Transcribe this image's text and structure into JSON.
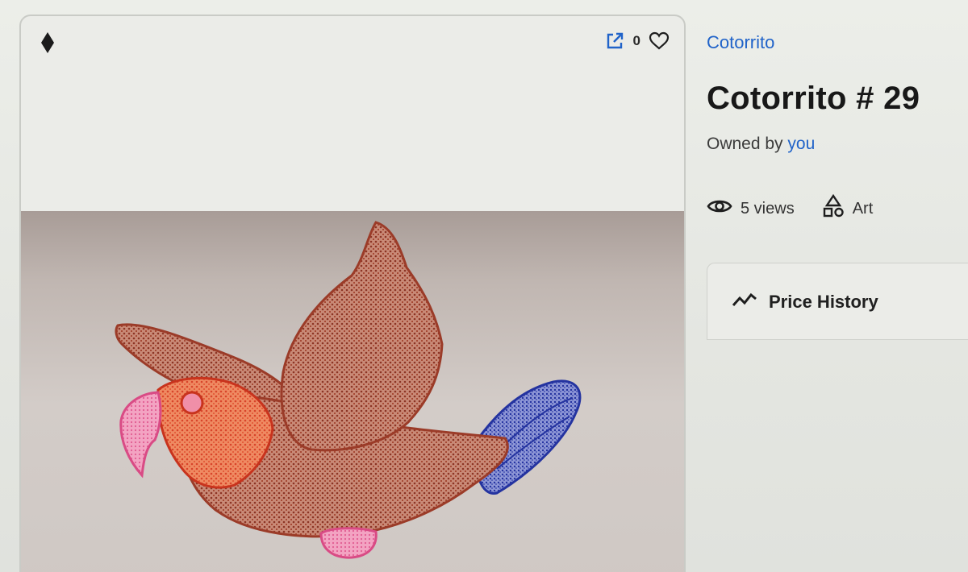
{
  "card": {
    "chain_icon": "ethereum-icon",
    "actions": {
      "open_icon": "external-link-icon",
      "like_count": "0",
      "like_icon": "heart-outline-icon"
    },
    "image": {
      "subject": "parrot-drawing",
      "colors": {
        "body": "#b25643",
        "head": "#e0603a",
        "beak": "#e77aa0",
        "tail": "#3b4ab0",
        "feet": "#ec79b0"
      }
    }
  },
  "details": {
    "collection": "Cotorrito",
    "title": "Cotorrito # 29",
    "owner_prefix": "Owned by",
    "owner_name": "you",
    "views_icon": "eye-icon",
    "views_label": "5 views",
    "category_icon": "shapes-icon",
    "category_label": "Art",
    "price_history": {
      "icon": "trend-line-icon",
      "label": "Price History"
    }
  },
  "colors": {
    "link": "#2063c9",
    "text": "#181818"
  }
}
